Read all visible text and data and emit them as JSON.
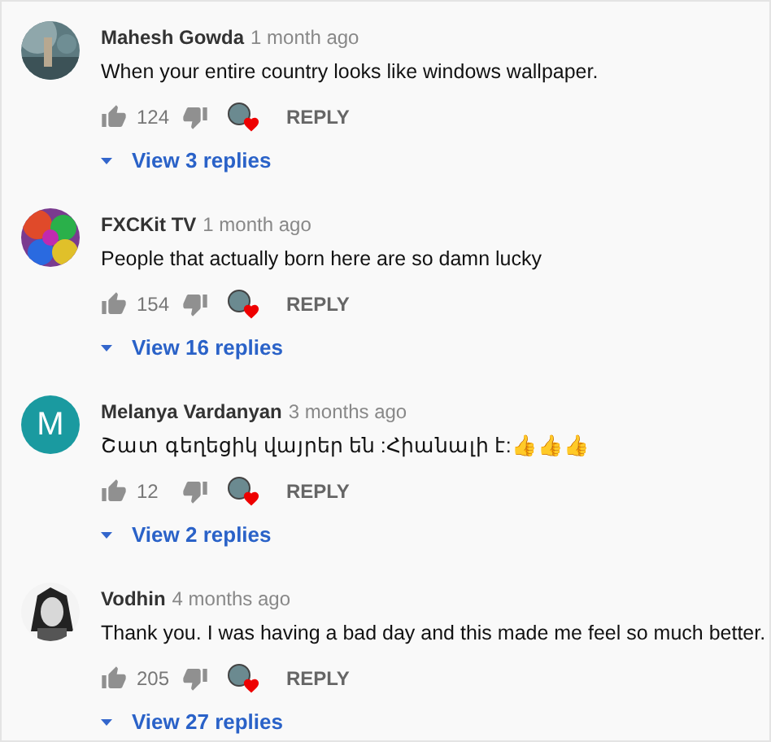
{
  "comments": [
    {
      "author": "Mahesh Gowda",
      "time": "1 month ago",
      "text": "When your entire country looks like windows wallpaper.",
      "likes": "124",
      "hearted": true,
      "reply": "REPLY",
      "view_replies": "View 3 replies"
    },
    {
      "author": "FXCKit TV",
      "time": "1 month ago",
      "text": "People that actually born here are so damn lucky",
      "likes": "154",
      "hearted": true,
      "reply": "REPLY",
      "view_replies": "View 16 replies"
    },
    {
      "author": "Melanya Vardanyan",
      "time": "3 months ago",
      "text": "Շատ գեղեցիկ վայրեր են :Հիանալի է:👍👍👍",
      "likes": "12",
      "hearted": true,
      "reply": "REPLY",
      "view_replies": "View 2 replies",
      "avatar": {
        "kind": "letter",
        "letter": "M",
        "color": "#1a9aa0"
      }
    },
    {
      "author": "Vodhin",
      "time": "4 months ago",
      "text": "Thank you. I was having a bad day and this made me feel so much better.",
      "likes": "205",
      "hearted": true,
      "reply": "REPLY",
      "view_replies": "View 27 replies"
    }
  ]
}
